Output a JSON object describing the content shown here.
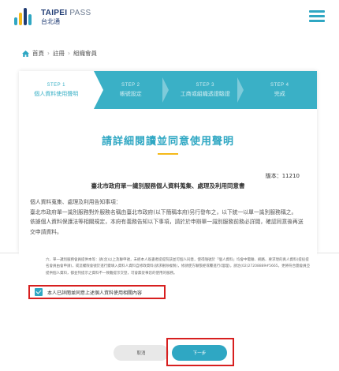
{
  "brand": {
    "name": "TAIPEI",
    "name_suffix": "PASS",
    "sub": "台北通"
  },
  "breadcrumb": [
    "首頁",
    "註冊",
    "組織會員"
  ],
  "steps": [
    {
      "num": "STEP 1",
      "label": "個人資料使用聲明"
    },
    {
      "num": "STEP 2",
      "label": "帳號設定"
    },
    {
      "num": "STEP 3",
      "label": "工商或組織透證驗證"
    },
    {
      "num": "STEP 4",
      "label": "完成"
    }
  ],
  "active_step": 1,
  "main": {
    "heading": "請詳細閱讀並同意使用聲明",
    "version": "版本：11210",
    "sub_title": "臺北市政府單一識別服務個人資料蒐集、處理及利用同意書",
    "body": [
      "個人資料蒐集、處理及利用告知事項：",
      "臺北市政府單一識別服務對外服務名稱由臺北市政府(以下簡稱本府)另行發布之，以下統一以單一識別服務稱之。",
      "依據個人資料保護法等相關規定，本府有義務告知以下事項，請於於申辦單一識別服務前務必詳閱，確認同意後再送交申請資料。"
    ]
  },
  "clause_text": "六、單一識別服務會員提供本等：請(含)以上及聯申號，未經本人既書者提提院該並可個人同意，使得隨號於「個人資料」均會中電聯、綱路、要求現的真人資料(提投提名會員由會申請)，或這權限會號於進行變填入資料人資料自修政資料(請求刪除複製)，修請使方聯張經或覆進行(理理)，請治(02)27208889#5665，更將符合團會員亞提供個人資料，都並列提示之資料不一致難提示交登，可會無從事您的使用的服務。",
  "agree": {
    "label": "本人已詳閱並同意上述個人資料使用相關內容",
    "checked": true
  },
  "buttons": {
    "cancel": "取消",
    "next": "下一步"
  },
  "colors": {
    "accent": "#2fa7c3",
    "highlight": "#d71f1f",
    "underline": "#f5b91a"
  }
}
